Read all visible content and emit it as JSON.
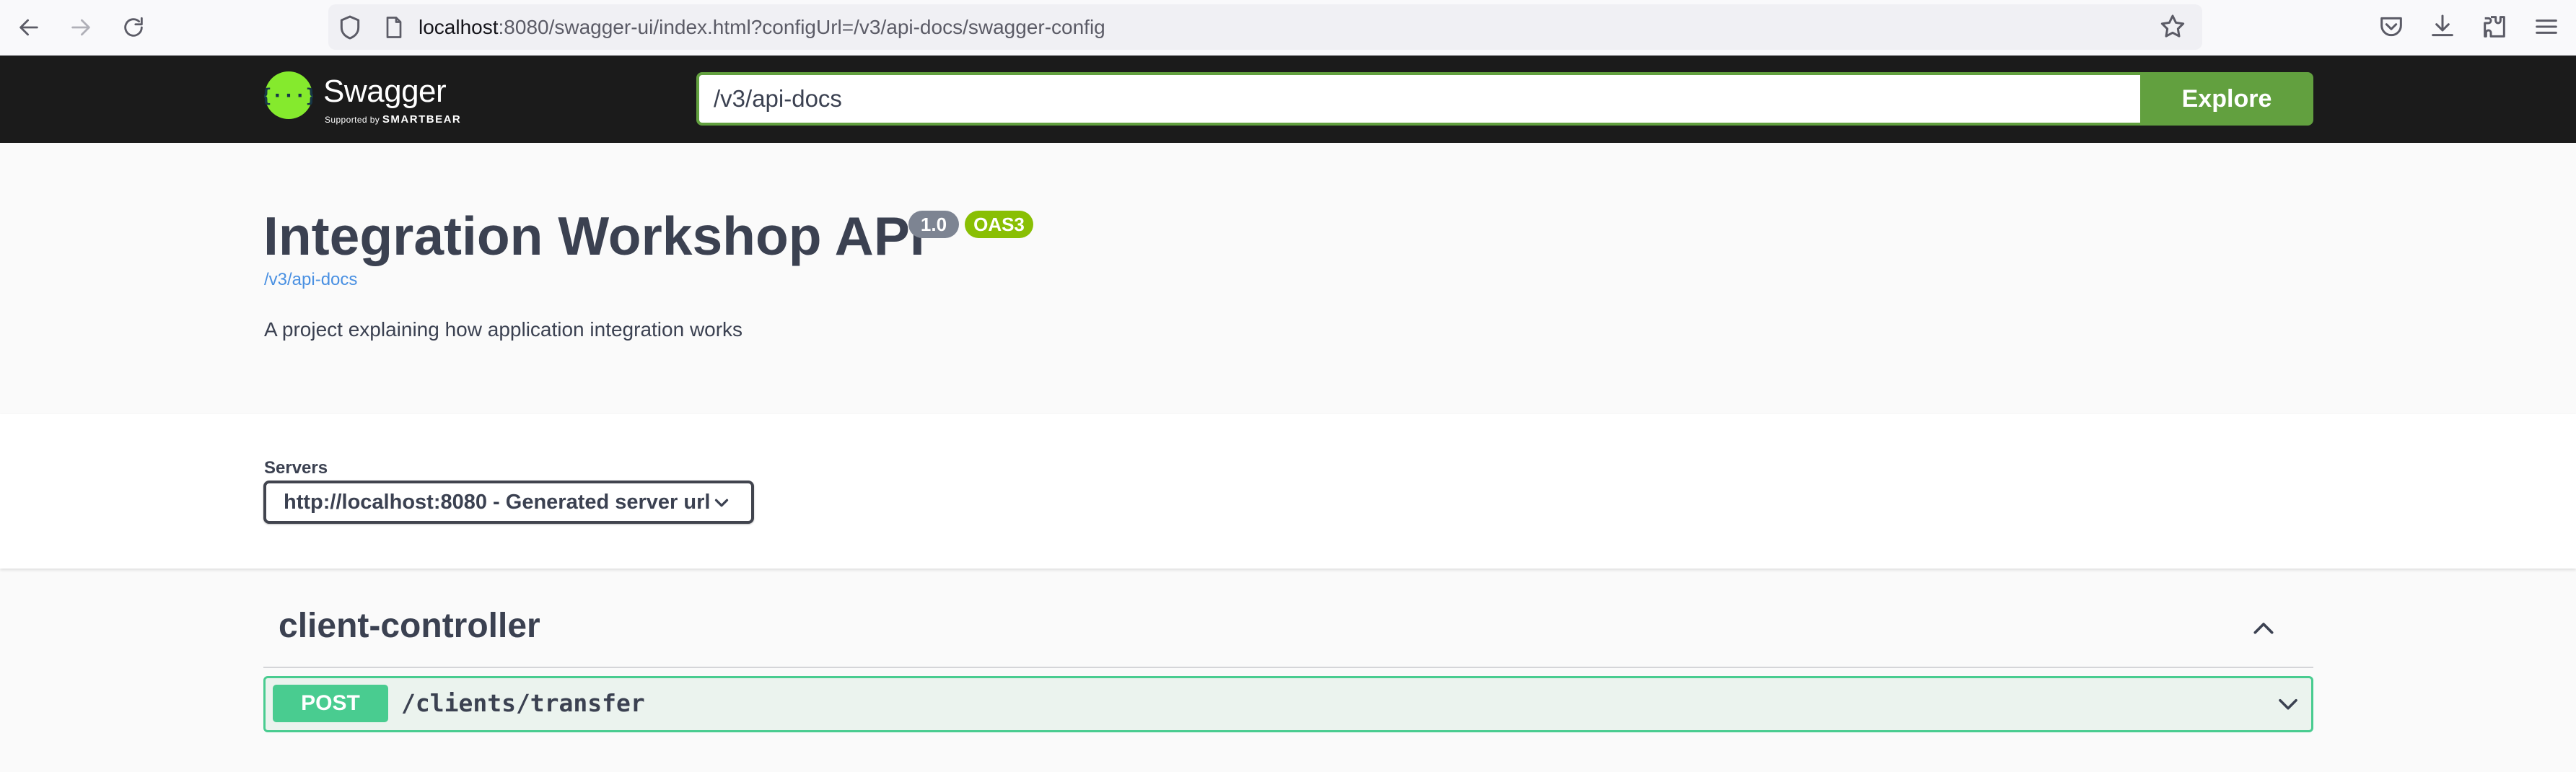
{
  "browser": {
    "url_host": "localhost",
    "url_rest": ":8080/swagger-ui/index.html?configUrl=/v3/api-docs/swagger-config"
  },
  "topbar": {
    "logo_text": "Swagger",
    "logo_subtext": "Supported by",
    "logo_brand": "SMARTBEAR",
    "explore_value": "/v3/api-docs",
    "explore_button": "Explore"
  },
  "info": {
    "title": "Integration Workshop API",
    "version": "1.0",
    "oas": "OAS3",
    "spec_link": "/v3/api-docs",
    "description": "A project explaining how application integration works"
  },
  "servers": {
    "label": "Servers",
    "selected": "http://localhost:8080 - Generated server url"
  },
  "tags": [
    {
      "name": "client-controller",
      "operations": [
        {
          "method": "POST",
          "path": "/clients/transfer"
        }
      ]
    }
  ],
  "colors": {
    "topbar_bg": "#1b1b1b",
    "accent_green": "#62a03f",
    "post_green": "#49cc90",
    "post_bg": "#ebf3ee",
    "version_badge": "#7d8492",
    "oas_badge": "#89bf04",
    "link_blue": "#4990e2"
  }
}
